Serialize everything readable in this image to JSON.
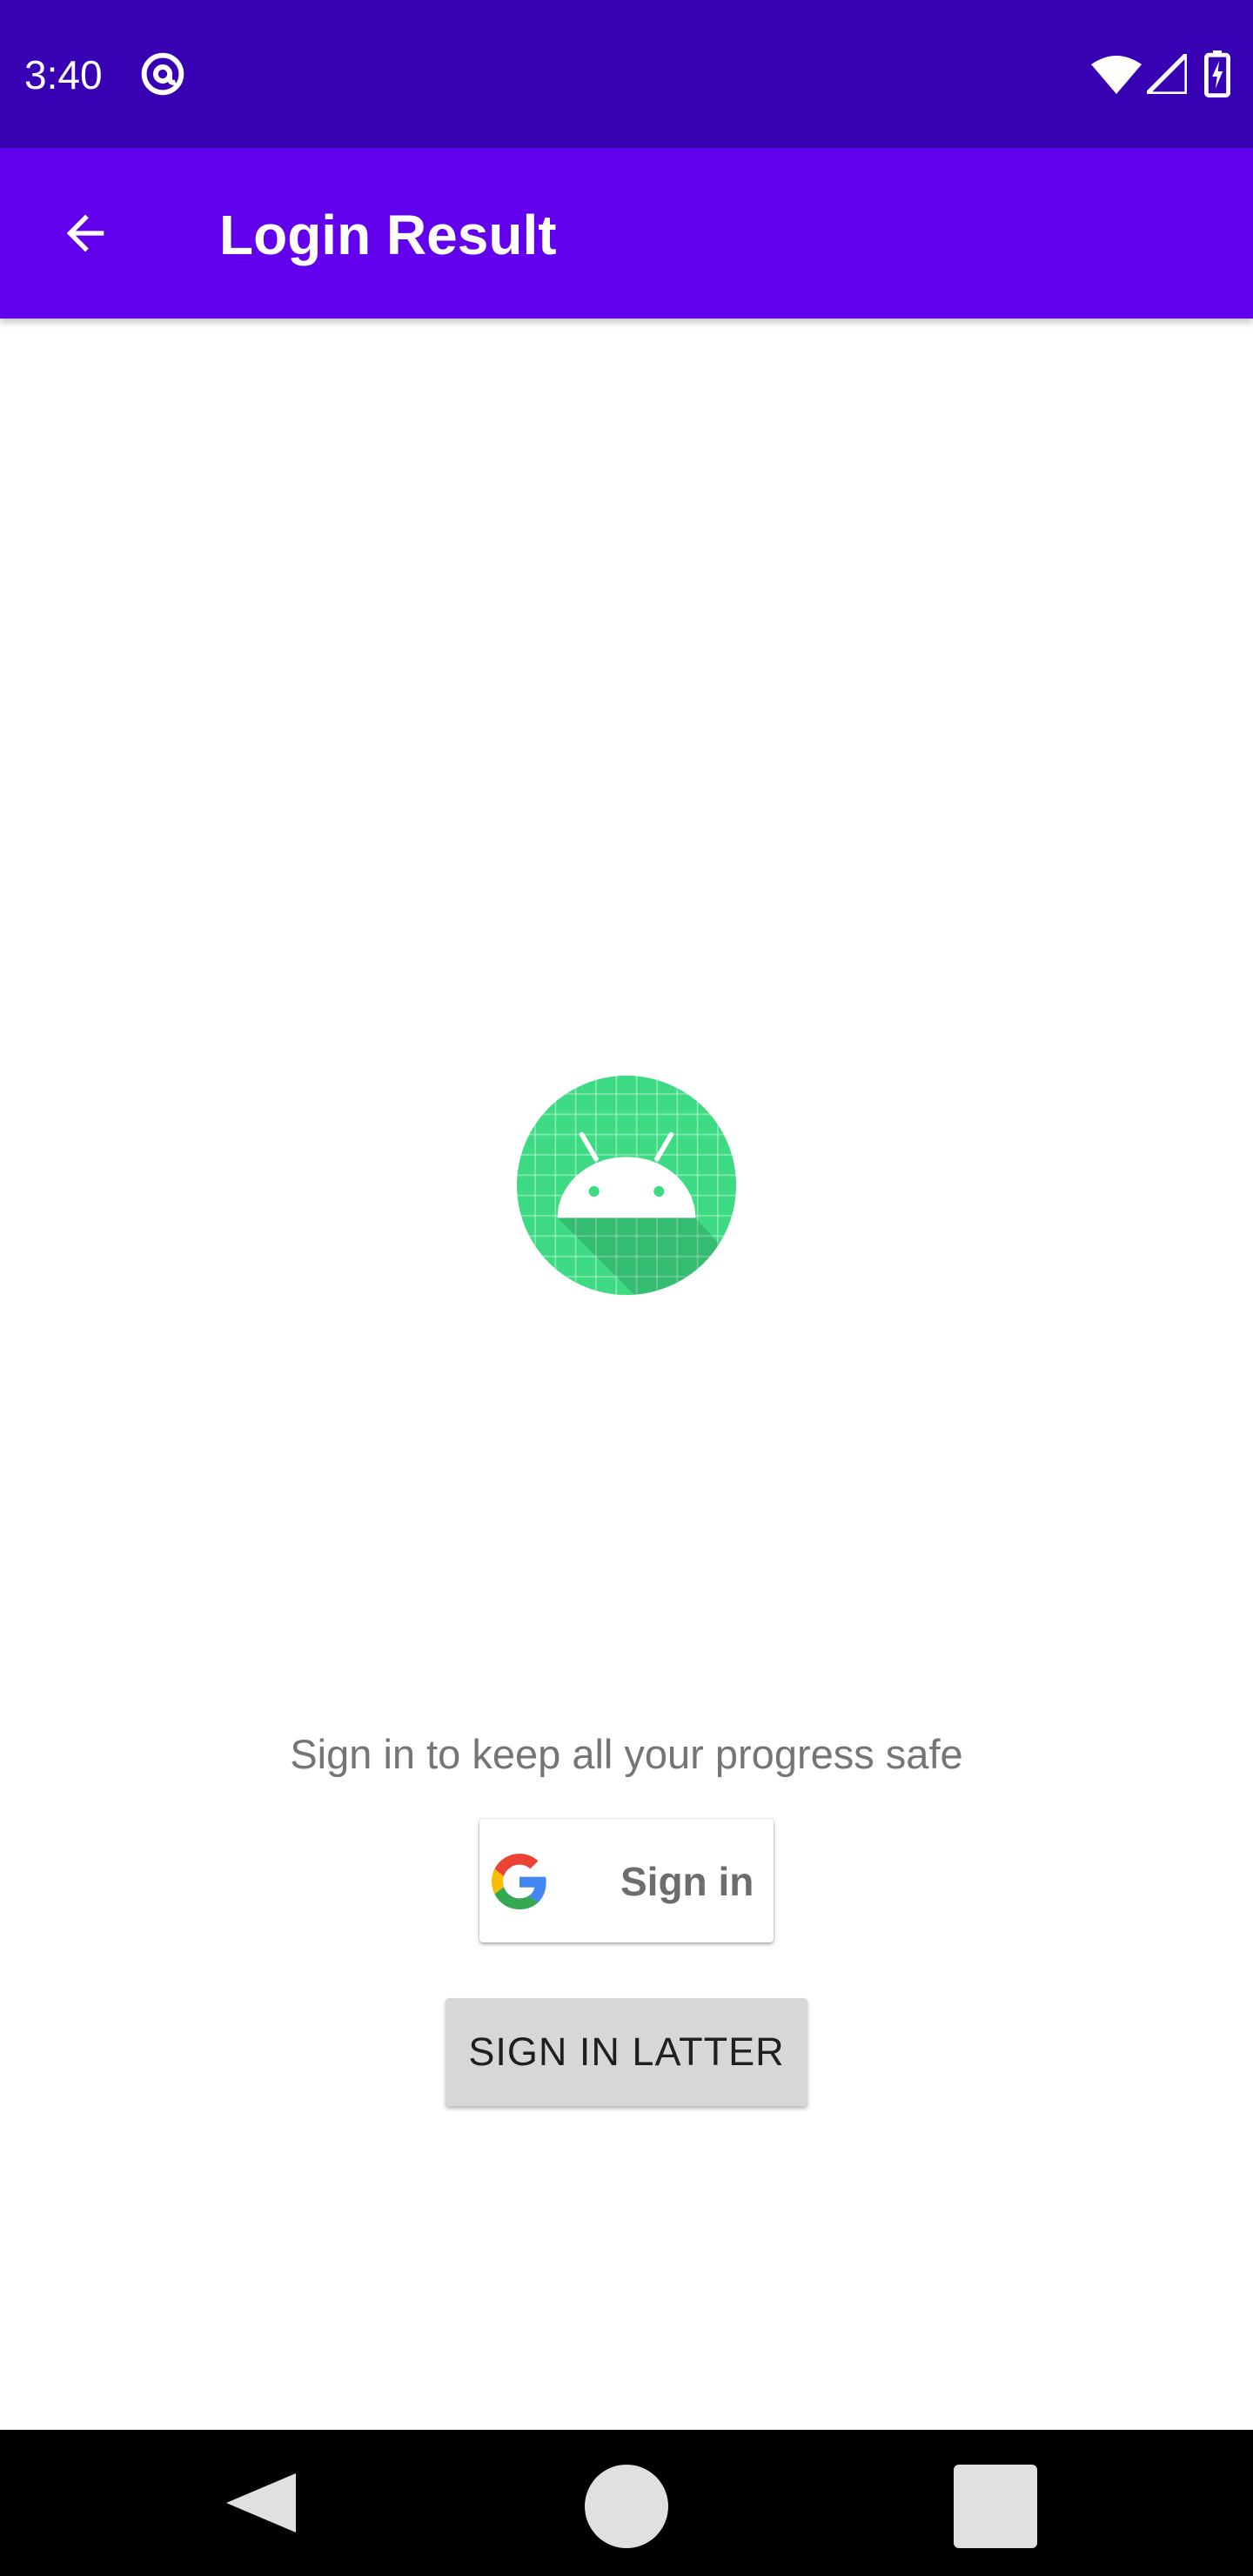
{
  "status_bar": {
    "time": "3:40",
    "icons": [
      "at-sign-icon",
      "wifi-icon",
      "signal-icon",
      "battery-charging-icon"
    ]
  },
  "app_bar": {
    "back_icon": "arrow-back-icon",
    "title": "Login Result"
  },
  "content": {
    "logo_icon": "android-logo-icon",
    "prompt": "Sign in to keep all your progress safe",
    "google_button": {
      "icon": "google-g-icon",
      "label": "Sign in"
    },
    "later_button": {
      "label": "SIGN IN LATTER"
    }
  },
  "nav_bar": {
    "icons": [
      "nav-back-icon",
      "nav-home-icon",
      "nav-recents-icon"
    ]
  },
  "colors": {
    "status_bar": "#3700b3",
    "app_bar": "#6200ee",
    "logo_green": "#3ddc84",
    "later_button_bg": "#d6d7d7",
    "prompt_text": "#757575"
  }
}
